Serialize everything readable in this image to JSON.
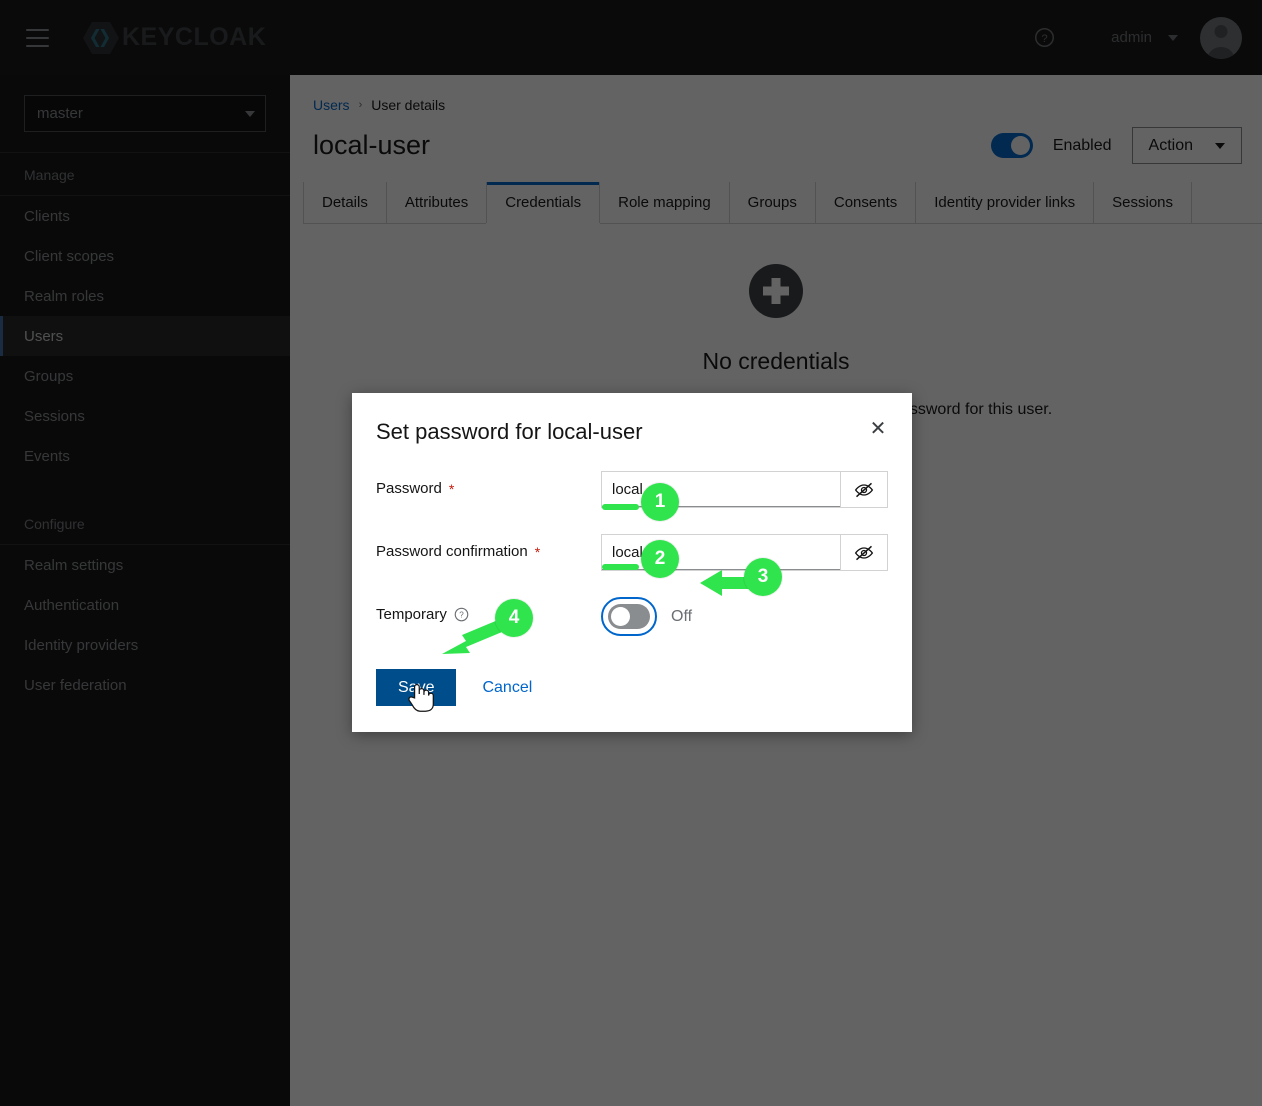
{
  "masthead": {
    "menu_icon": "hamburger-icon",
    "brand_text": "KEYCLOAK",
    "help_icon": "help-circle-icon",
    "user_name": "admin",
    "avatar_icon": "user-avatar-icon"
  },
  "sidebar": {
    "realm_selected": "master",
    "groups": [
      {
        "title": "Manage",
        "items": [
          {
            "label": "Clients",
            "active": false
          },
          {
            "label": "Client scopes",
            "active": false
          },
          {
            "label": "Realm roles",
            "active": false
          },
          {
            "label": "Users",
            "active": true
          },
          {
            "label": "Groups",
            "active": false
          },
          {
            "label": "Sessions",
            "active": false
          },
          {
            "label": "Events",
            "active": false
          }
        ]
      },
      {
        "title": "Configure",
        "items": [
          {
            "label": "Realm settings",
            "active": false
          },
          {
            "label": "Authentication",
            "active": false
          },
          {
            "label": "Identity providers",
            "active": false
          },
          {
            "label": "User federation",
            "active": false
          }
        ]
      }
    ]
  },
  "breadcrumb": {
    "parent": "Users",
    "separator": "›",
    "current": "User details"
  },
  "page": {
    "title": "local-user",
    "enabled_label": "Enabled",
    "enabled_state": "on",
    "action_label": "Action"
  },
  "tabs": [
    {
      "label": "Details",
      "active": false
    },
    {
      "label": "Attributes",
      "active": false
    },
    {
      "label": "Credentials",
      "active": true
    },
    {
      "label": "Role mapping",
      "active": false
    },
    {
      "label": "Groups",
      "active": false
    },
    {
      "label": "Consents",
      "active": false
    },
    {
      "label": "Identity provider links",
      "active": false
    },
    {
      "label": "Sessions",
      "active": false
    }
  ],
  "empty_state": {
    "icon": "plus-circle-icon",
    "title": "No credentials",
    "description": "This user does not have any credentials. You can set a password for this user."
  },
  "modal": {
    "title": "Set password for local-user",
    "close_icon": "close-icon",
    "fields": {
      "password": {
        "label": "Password",
        "required_marker": "*",
        "value": "local",
        "toggle_icon": "eye-slash-icon"
      },
      "password_confirmation": {
        "label": "Password confirmation",
        "required_marker": "*",
        "value": "local",
        "toggle_icon": "eye-slash-icon"
      },
      "temporary": {
        "label": "Temporary",
        "help_icon": "help-circle-icon",
        "state_label": "Off",
        "state": "off"
      }
    },
    "save_label": "Save",
    "cancel_label": "Cancel"
  },
  "annotations": {
    "accent_color": "#2fe44c",
    "steps": [
      {
        "number": "1",
        "target": "password-input"
      },
      {
        "number": "2",
        "target": "password-confirmation-input"
      },
      {
        "number": "3",
        "target": "temporary-toggle"
      },
      {
        "number": "4",
        "target": "save-button"
      }
    ]
  },
  "colors": {
    "masthead_bg": "#151515",
    "sidebar_bg": "#141414",
    "primary_blue": "#06c",
    "save_blue": "#004d8c",
    "active_nav_accent": "#3f6fa8",
    "required_red": "#c9190b"
  }
}
